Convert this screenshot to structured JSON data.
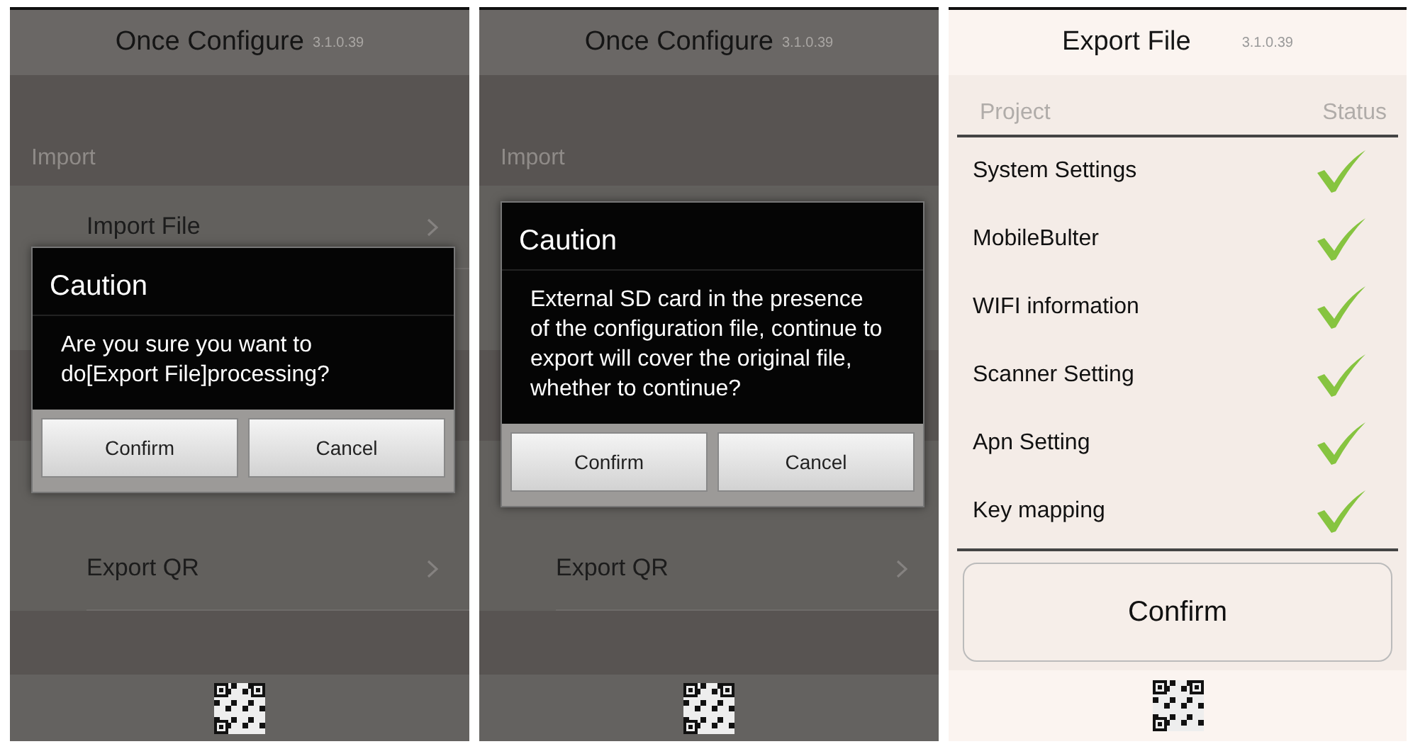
{
  "screens": [
    {
      "kind": "menu",
      "title": "Once Configure",
      "version": "3.1.0.39",
      "section_label": "Import",
      "import_rows": [
        "Import File"
      ],
      "export_rows": [
        "Export QR"
      ],
      "dialog": {
        "title": "Caution",
        "message": "Are you sure you want to do[Export File]processing?",
        "buttons": [
          "Confirm",
          "Cancel"
        ]
      }
    },
    {
      "kind": "menu",
      "title": "Once Configure",
      "version": "3.1.0.39",
      "section_label": "Import",
      "export_rows": [
        "Export QR"
      ],
      "dialog": {
        "title": "Caution",
        "message": "External SD card in the presence of the configuration file, continue to export will cover the original file, whether to continue?",
        "buttons": [
          "Confirm",
          "Cancel"
        ]
      }
    },
    {
      "kind": "export",
      "title": "Export File",
      "version": "3.1.0.39",
      "columns": [
        "Project",
        "Status"
      ],
      "rows": [
        {
          "name": "System Settings",
          "done": true
        },
        {
          "name": "MobileBulter",
          "done": true
        },
        {
          "name": "WIFI information",
          "done": true
        },
        {
          "name": "Scanner Setting",
          "done": true
        },
        {
          "name": "Apn Setting",
          "done": true
        },
        {
          "name": "Key mapping",
          "done": true
        }
      ],
      "confirm": "Confirm"
    }
  ]
}
